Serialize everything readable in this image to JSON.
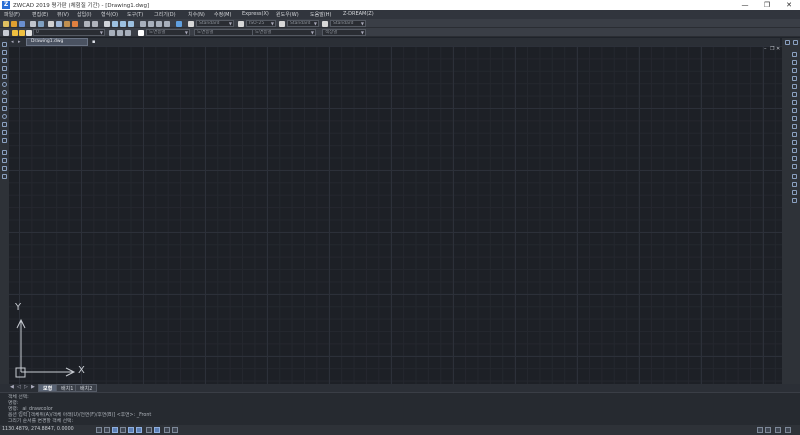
{
  "window": {
    "app_logo": "Z",
    "title": "ZWCAD 2019 평가판 (체험질 기간) - [Drawing1.dwg]",
    "buttons": [
      "—",
      "❐",
      "✕"
    ]
  },
  "menu": {
    "items": [
      "파일(F)",
      "편집(E)",
      "뷰(V)",
      "삽입(I)",
      "형식(O)",
      "도구(T)",
      "그리기(D)",
      "치수(N)",
      "수정(M)",
      "Express(X)",
      "윈도우(W)",
      "도움말(H)",
      "Z-DREAM(Z)"
    ]
  },
  "toolbar": {
    "text_style": "Standard",
    "dim_style": "ISO-25",
    "table_style": "Standard",
    "multileader_style": "Standard",
    "layer": "0",
    "color": "도면층별",
    "linetype": "도면층별",
    "lineweight": "도면층별",
    "plot_style": "색상별"
  },
  "document": {
    "tab_label": "Drawing1.dwg",
    "new_tab_icon": "new-tab-icon"
  },
  "viewport": {
    "minimize": "–",
    "restore": "❐",
    "close": "✕"
  },
  "ucs": {
    "x_label": "X",
    "y_label": "Y"
  },
  "layout": {
    "nav": [
      "◀",
      "◁",
      "▷",
      "▶"
    ],
    "tabs": [
      "모형",
      "배치1",
      "배치2"
    ],
    "active_tab": "모형"
  },
  "command": {
    "lines": [
      "객체 선택:",
      "명령:",
      "명령: _ai_drawcolor",
      "옵션 입력 [객체위(A)/객체 아래(U)/전면(F)/후면(B)] <후면>: _Front",
      "그리기 순서를 변경할 객체 선택:"
    ]
  },
  "status": {
    "coordinates": "1130.4879, 274.8847, 0.0000"
  },
  "colors": {
    "canvas": "#1d2026",
    "chrome": "#2e3238",
    "accent": "#5c7fb5"
  }
}
